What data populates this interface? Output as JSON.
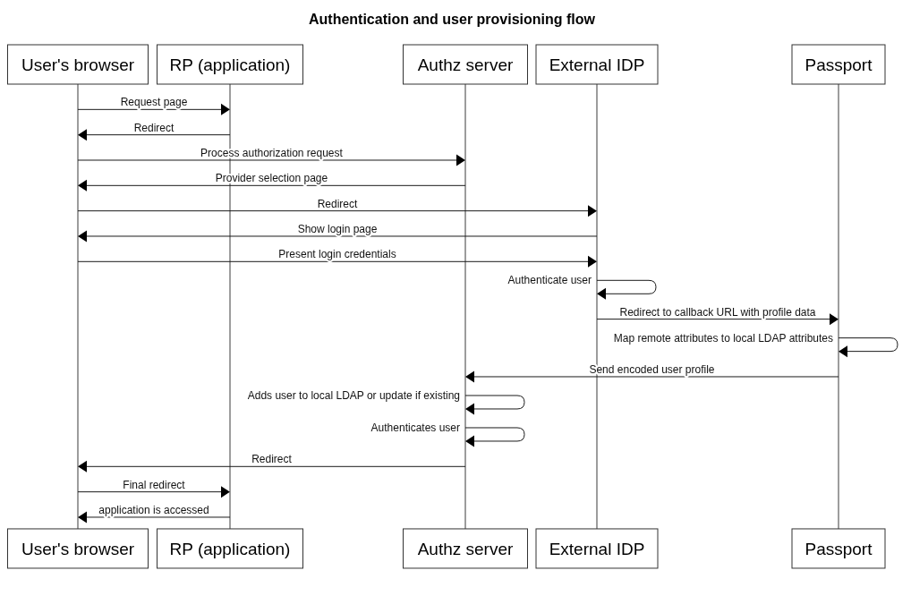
{
  "title": "Authentication and user provisioning flow",
  "participants": [
    {
      "top": "User's browser",
      "bottom": "User's browser"
    },
    {
      "top": "RP (application)",
      "bottom": "RP (application)"
    },
    {
      "top": "Authz server",
      "bottom": "Authz server"
    },
    {
      "top": "External IDP",
      "bottom": "External IDP"
    },
    {
      "top": "Passport",
      "bottom": "Passport"
    }
  ],
  "messages": [
    {
      "text": "Request page"
    },
    {
      "text": "Redirect"
    },
    {
      "text": "Process authorization request"
    },
    {
      "text": "Provider selection page"
    },
    {
      "text": "Redirect"
    },
    {
      "text": "Show login page"
    },
    {
      "text": "Present login credentials"
    },
    {
      "text": "Authenticate user"
    },
    {
      "text": "Redirect to callback URL with profile data"
    },
    {
      "text": "Map remote attributes to local LDAP attributes"
    },
    {
      "text": "Send encoded user profile"
    },
    {
      "text": "Adds user to local LDAP or update if existing"
    },
    {
      "text": "Authenticates user"
    },
    {
      "text": "Redirect"
    },
    {
      "text": "Final redirect"
    },
    {
      "text": "application is accessed"
    }
  ]
}
